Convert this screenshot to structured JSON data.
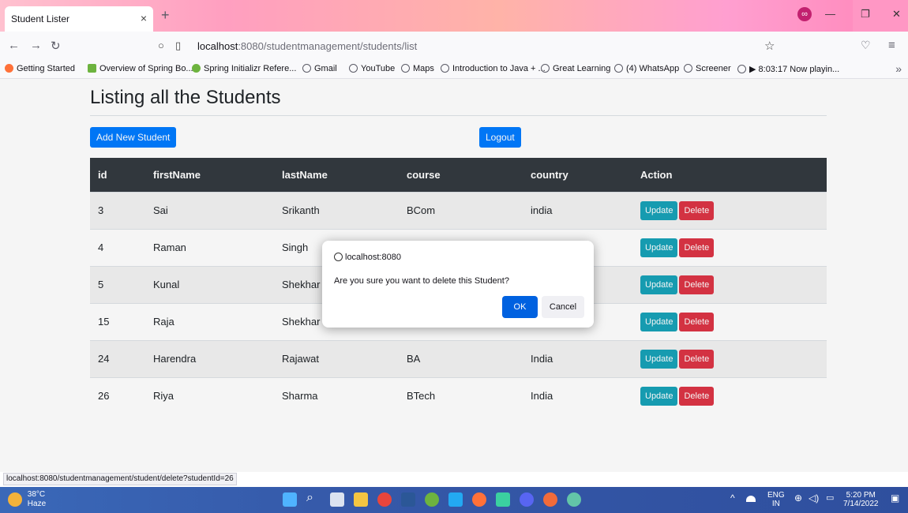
{
  "browser": {
    "tab_title": "Student Lister",
    "tab_close": "×",
    "new_tab": "+",
    "url_host": "localhost",
    "url_path": ":8080/studentmanagement/students/list",
    "bookmarks": [
      {
        "label": "Getting Started",
        "icon": "firefox-icon"
      },
      {
        "label": "Overview of Spring Bo...",
        "icon": "spring-icon"
      },
      {
        "label": "Spring Initializr Refere...",
        "icon": "spring-icon"
      },
      {
        "label": "Gmail",
        "icon": "globe-icon"
      },
      {
        "label": "YouTube",
        "icon": "globe-icon"
      },
      {
        "label": "Maps",
        "icon": "globe-icon"
      },
      {
        "label": "Introduction to Java + ...",
        "icon": "globe-icon"
      },
      {
        "label": "Great Learning",
        "icon": "globe-icon"
      },
      {
        "label": "(4) WhatsApp",
        "icon": "globe-icon"
      },
      {
        "label": "Screener",
        "icon": "globe-icon"
      },
      {
        "label": "▶ 8:03:17 Now playin...",
        "icon": "globe-icon"
      }
    ],
    "status_link": "localhost:8080/studentmanagement/student/delete?studentId=26"
  },
  "page": {
    "title": "Listing all the Students",
    "add_button": "Add New Student",
    "logout_button": "Logout",
    "columns": [
      "id",
      "firstName",
      "lastName",
      "course",
      "country",
      "Action"
    ],
    "rows": [
      {
        "id": "3",
        "firstName": "Sai",
        "lastName": "Srikanth",
        "course": "BCom",
        "country": "india"
      },
      {
        "id": "4",
        "firstName": "Raman",
        "lastName": "Singh",
        "course": "",
        "country": ""
      },
      {
        "id": "5",
        "firstName": "Kunal",
        "lastName": "Shekhar",
        "course": "",
        "country": ""
      },
      {
        "id": "15",
        "firstName": "Raja",
        "lastName": "Shekhar",
        "course": "",
        "country": ""
      },
      {
        "id": "24",
        "firstName": "Harendra",
        "lastName": "Rajawat",
        "course": "BA",
        "country": "India"
      },
      {
        "id": "26",
        "firstName": "Riya",
        "lastName": "Sharma",
        "course": "BTech",
        "country": "India"
      }
    ],
    "update_label": "Update",
    "delete_label": "Delete"
  },
  "dialog": {
    "origin": "localhost:8080",
    "message": "Are you sure you want to delete this Student?",
    "ok": "OK",
    "cancel": "Cancel"
  },
  "taskbar": {
    "temperature": "38°C",
    "condition": "Haze",
    "lang_top": "ENG",
    "lang_bottom": "IN",
    "time": "5:20 PM",
    "date": "7/14/2022"
  }
}
